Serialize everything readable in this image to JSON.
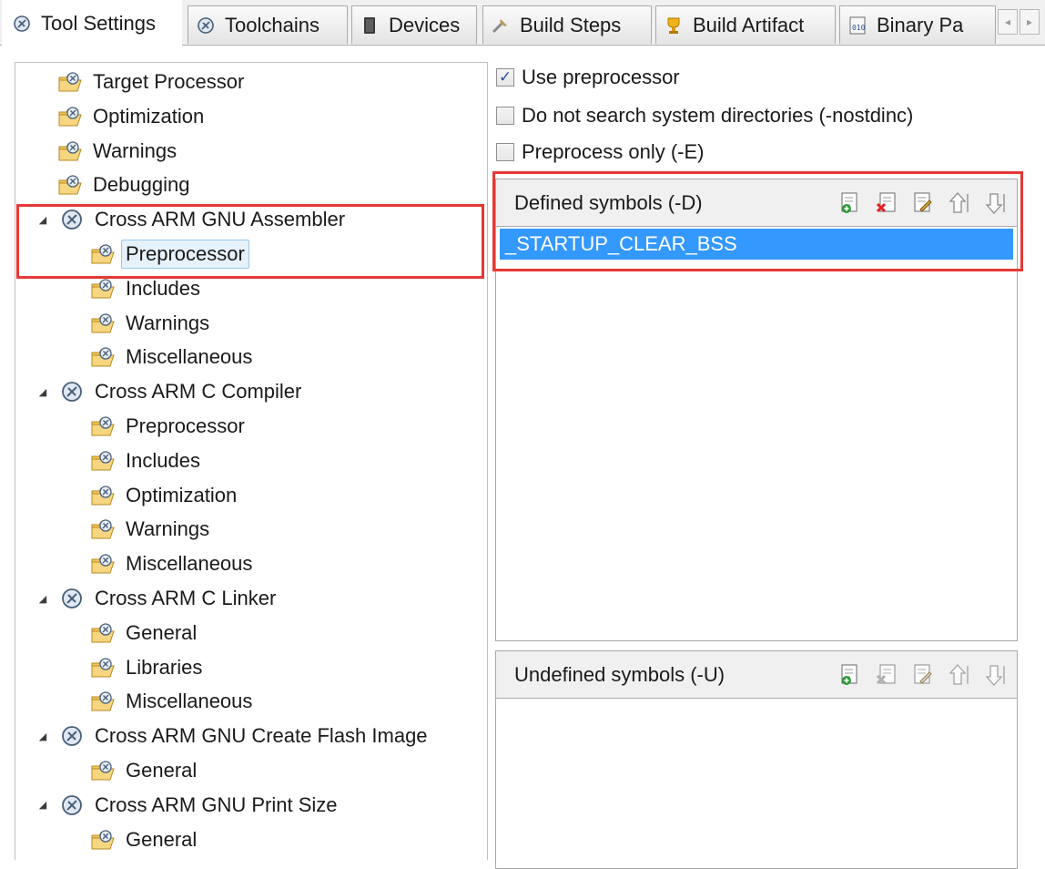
{
  "tabs": [
    {
      "label": "Tool Settings",
      "icon": "tool-settings-icon",
      "active": true
    },
    {
      "label": "Toolchains",
      "icon": "toolchains-icon"
    },
    {
      "label": "Devices",
      "icon": "devices-icon"
    },
    {
      "label": "Build Steps",
      "icon": "build-steps-icon"
    },
    {
      "label": "Build Artifact",
      "icon": "build-artifact-icon"
    },
    {
      "label": "Binary Pa",
      "icon": "binary-parsers-icon"
    }
  ],
  "tab_scroll": {
    "left": "◂",
    "right": "▸"
  },
  "tree": [
    {
      "label": "Target Processor",
      "level": 1
    },
    {
      "label": "Optimization",
      "level": 1
    },
    {
      "label": "Warnings",
      "level": 1
    },
    {
      "label": "Debugging",
      "level": 1
    },
    {
      "label": "Cross ARM GNU Assembler",
      "level": 0,
      "expanded": true
    },
    {
      "label": "Preprocessor",
      "level": 1,
      "selected": true
    },
    {
      "label": "Includes",
      "level": 1
    },
    {
      "label": "Warnings",
      "level": 1
    },
    {
      "label": "Miscellaneous",
      "level": 1
    },
    {
      "label": "Cross ARM C Compiler",
      "level": 0,
      "expanded": true
    },
    {
      "label": "Preprocessor",
      "level": 1
    },
    {
      "label": "Includes",
      "level": 1
    },
    {
      "label": "Optimization",
      "level": 1
    },
    {
      "label": "Warnings",
      "level": 1
    },
    {
      "label": "Miscellaneous",
      "level": 1
    },
    {
      "label": "Cross ARM C Linker",
      "level": 0,
      "expanded": true
    },
    {
      "label": "General",
      "level": 1
    },
    {
      "label": "Libraries",
      "level": 1
    },
    {
      "label": "Miscellaneous",
      "level": 1
    },
    {
      "label": "Cross ARM GNU Create Flash Image",
      "level": 0,
      "expanded": true
    },
    {
      "label": "General",
      "level": 1
    },
    {
      "label": "Cross ARM GNU Print Size",
      "level": 0,
      "expanded": true
    },
    {
      "label": "General",
      "level": 1
    }
  ],
  "options": [
    {
      "label": "Use preprocessor",
      "checked": true
    },
    {
      "label": "Do not search system directories (-nostdinc)",
      "checked": false
    },
    {
      "label": "Preprocess only (-E)",
      "checked": false
    }
  ],
  "defined_symbols": {
    "title": "Defined symbols (-D)",
    "items": [
      "_STARTUP_CLEAR_BSS"
    ]
  },
  "undefined_symbols": {
    "title": "Undefined symbols (-U)",
    "items": []
  },
  "toolbar_icons": [
    "add-icon",
    "delete-icon",
    "edit-icon",
    "move-up-icon",
    "move-down-icon"
  ],
  "colors": {
    "highlight": "#e53935",
    "selection": "#3399ff"
  }
}
